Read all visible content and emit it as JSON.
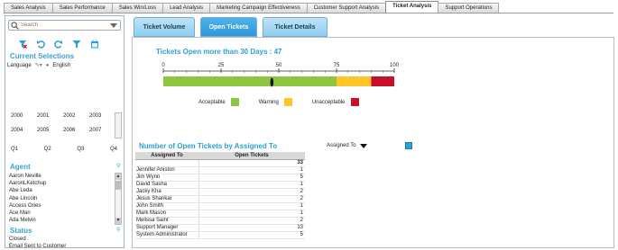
{
  "sheet_tabs": [
    {
      "label": "Sales Analysis",
      "active": false
    },
    {
      "label": "Sales Performance",
      "active": false
    },
    {
      "label": "Sales Win/Loss",
      "active": false
    },
    {
      "label": "Lead Analysis",
      "active": false
    },
    {
      "label": "Marketing Campaign Effectiveness",
      "active": false
    },
    {
      "label": "Customer Support Analysis",
      "active": false
    },
    {
      "label": "Ticket Analysis",
      "active": true
    },
    {
      "label": "Support Operations",
      "active": false
    }
  ],
  "left": {
    "search_placeholder": "Search",
    "current_selections_title": "Current Selections",
    "language_label": "Language",
    "language_value": "English",
    "years": [
      "2000",
      "2001",
      "2002",
      "2003",
      "2004",
      "2005",
      "2006",
      "2007"
    ],
    "quarters": [
      "Q1",
      "Q2",
      "Q3",
      "Q4"
    ],
    "agent_title": "Agent",
    "agents": [
      "Aaron Neville",
      "AaronLKetchup",
      "Abe Leda",
      "Abe Lincoln",
      "Access Ories",
      "Ace Man",
      "Ada Melvin"
    ],
    "status_title": "Status",
    "statuses": [
      "Closed",
      "Email Sent to Customer"
    ]
  },
  "tabs": [
    {
      "label": "Ticket Volume",
      "active": false
    },
    {
      "label": "Open Tickets",
      "active": true
    },
    {
      "label": "Ticket Details",
      "active": false
    }
  ],
  "gauge": {
    "title": "Tickets Open more than 30 Days : 47",
    "value": 47,
    "min": 0,
    "max": 100,
    "ticks": [
      "0",
      "25",
      "50",
      "75",
      "100"
    ],
    "bands": [
      {
        "from": 0,
        "to": 75,
        "color": "#8dc63f"
      },
      {
        "from": 75,
        "to": 90,
        "color": "#ffc629"
      },
      {
        "from": 90,
        "to": 100,
        "color": "#c8102e"
      }
    ]
  },
  "legend": [
    {
      "label": "Acceptable",
      "color": "#8dc63f"
    },
    {
      "label": "Warning",
      "color": "#ffc629"
    },
    {
      "label": "Unacceptable",
      "color": "#c8102e"
    }
  ],
  "table": {
    "title": "Number of Open Tickets by Assigned To",
    "filter_label": "Assigned To",
    "columns": [
      "Assigned To",
      "Open Tickets"
    ],
    "total": "33",
    "rows": [
      {
        "name": "Jennifer Aniston",
        "value": "1"
      },
      {
        "name": "Jim Wynn",
        "value": "5"
      },
      {
        "name": "David Sasha",
        "value": "1"
      },
      {
        "name": "Jacky Kha",
        "value": "2"
      },
      {
        "name": "Jesus Shankar",
        "value": "2"
      },
      {
        "name": "John Smith",
        "value": "1"
      },
      {
        "name": "Mark Mason",
        "value": "1"
      },
      {
        "name": "Melissa Saint",
        "value": "2"
      },
      {
        "name": "Support Manager",
        "value": "13"
      },
      {
        "name": "System Administrator",
        "value": "5"
      }
    ]
  },
  "chart_data": {
    "type": "table",
    "title": "Number of Open Tickets by Assigned To",
    "columns": [
      "Assigned To",
      "Open Tickets"
    ],
    "total": 33,
    "categories": [
      "Jennifer Aniston",
      "Jim Wynn",
      "David Sasha",
      "Jacky Kha",
      "Jesus Shankar",
      "John Smith",
      "Mark Mason",
      "Melissa Saint",
      "Support Manager",
      "System Administrator"
    ],
    "values": [
      1,
      5,
      1,
      2,
      2,
      1,
      1,
      2,
      13,
      5
    ]
  }
}
